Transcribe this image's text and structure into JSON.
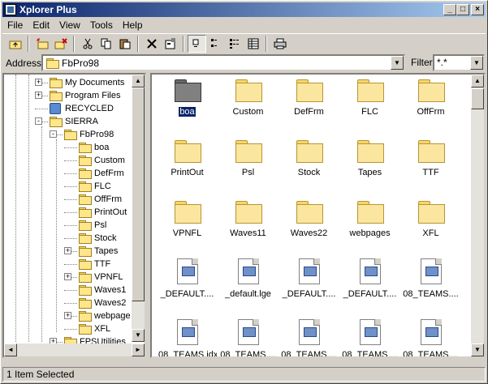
{
  "window": {
    "title": "Xplorer Plus"
  },
  "titlebar_buttons": [
    "_",
    "□",
    "×"
  ],
  "menu": [
    "File",
    "Edit",
    "View",
    "Tools",
    "Help"
  ],
  "toolbar": {
    "icons": [
      "up-folder-icon",
      "new-folder-icon",
      "delete-folder-icon",
      "cut-icon",
      "copy-icon",
      "paste-icon",
      "delete-icon",
      "properties-icon",
      "large-icons-icon",
      "small-icons-icon",
      "list-view-icon",
      "details-view-icon",
      "print-icon"
    ],
    "active_view": "large-icons"
  },
  "address": {
    "label": "Address",
    "value": "FbPro98"
  },
  "filter": {
    "label": "Filter",
    "value": "*.*"
  },
  "tree": [
    {
      "label": "My Documents",
      "level": 3,
      "expander": "+"
    },
    {
      "label": "Program Files",
      "level": 3,
      "expander": "+"
    },
    {
      "label": "RECYCLED",
      "level": 3,
      "expander": "",
      "icon": "recycle-bin-icon"
    },
    {
      "label": "SIERRA",
      "level": 3,
      "expander": "-"
    },
    {
      "label": "FbPro98",
      "level": 4,
      "expander": "-"
    },
    {
      "label": "boa",
      "level": 5,
      "expander": ""
    },
    {
      "label": "Custom",
      "level": 5,
      "expander": ""
    },
    {
      "label": "DefFrm",
      "level": 5,
      "expander": ""
    },
    {
      "label": "FLC",
      "level": 5,
      "expander": ""
    },
    {
      "label": "OffFrm",
      "level": 5,
      "expander": ""
    },
    {
      "label": "PrintOut",
      "level": 5,
      "expander": ""
    },
    {
      "label": "Psl",
      "level": 5,
      "expander": ""
    },
    {
      "label": "Stock",
      "level": 5,
      "expander": ""
    },
    {
      "label": "Tapes",
      "level": 5,
      "expander": "+"
    },
    {
      "label": "TTF",
      "level": 5,
      "expander": ""
    },
    {
      "label": "VPNFL",
      "level": 5,
      "expander": "+"
    },
    {
      "label": "Waves1",
      "level": 5,
      "expander": ""
    },
    {
      "label": "Waves2",
      "level": 5,
      "expander": ""
    },
    {
      "label": "webpage",
      "level": 5,
      "expander": "+"
    },
    {
      "label": "XFL",
      "level": 5,
      "expander": ""
    },
    {
      "label": "FPSUtilities",
      "level": 4,
      "expander": "+"
    }
  ],
  "items": [
    {
      "label": "boa",
      "type": "folder",
      "selected": true
    },
    {
      "label": "Custom",
      "type": "folder"
    },
    {
      "label": "DefFrm",
      "type": "folder"
    },
    {
      "label": "FLC",
      "type": "folder"
    },
    {
      "label": "OffFrm",
      "type": "folder"
    },
    {
      "label": "PrintOut",
      "type": "folder"
    },
    {
      "label": "Psl",
      "type": "folder"
    },
    {
      "label": "Stock",
      "type": "folder"
    },
    {
      "label": "Tapes",
      "type": "folder"
    },
    {
      "label": "TTF",
      "type": "folder"
    },
    {
      "label": "VPNFL",
      "type": "folder"
    },
    {
      "label": "Waves11",
      "type": "folder"
    },
    {
      "label": "Waves22",
      "type": "folder"
    },
    {
      "label": "webpages",
      "type": "folder"
    },
    {
      "label": "XFL",
      "type": "folder"
    },
    {
      "label": "_DEFAULT....",
      "type": "file"
    },
    {
      "label": "_default.lge",
      "type": "file"
    },
    {
      "label": "_DEFAULT....",
      "type": "file"
    },
    {
      "label": "_DEFAULT....",
      "type": "file"
    },
    {
      "label": "08_TEAMS....",
      "type": "file"
    },
    {
      "label": "08_TEAMS.idx",
      "type": "file"
    },
    {
      "label": "08_TEAMS....",
      "type": "file"
    },
    {
      "label": "08_TEAMS....",
      "type": "file"
    },
    {
      "label": "08_TEAMS....",
      "type": "file"
    },
    {
      "label": "08_TEAMS....",
      "type": "file"
    }
  ],
  "status": {
    "text": "1 Item Selected"
  }
}
